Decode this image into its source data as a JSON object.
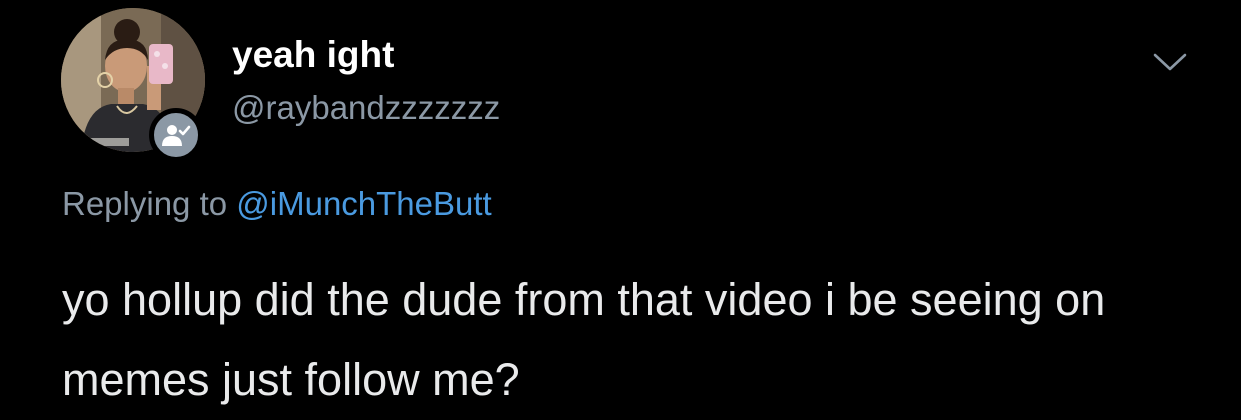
{
  "author": {
    "display_name": "yeah ight",
    "handle": "@raybandzzzzzzz",
    "avatar_icon": "profile-photo",
    "follows_you_icon": "follows-you-person-check-icon"
  },
  "menu": {
    "icon": "chevron-down-icon"
  },
  "reply": {
    "prefix": "Replying to ",
    "handle": "@iMunchTheButt"
  },
  "tweet": {
    "text": "yo hollup did the dude from that video i be seeing on memes just follow me?"
  },
  "colors": {
    "background": "#000000",
    "muted": "#8b98a5",
    "link": "#4a9ae0",
    "text": "#e9eaeb"
  }
}
